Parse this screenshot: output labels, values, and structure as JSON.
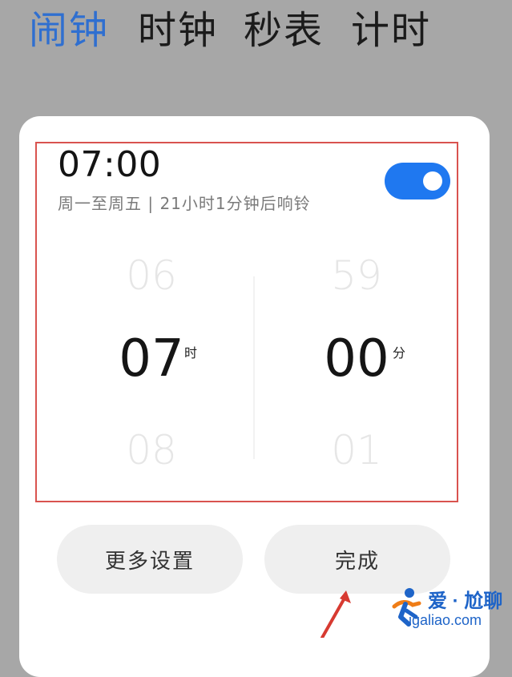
{
  "tabs": [
    {
      "label": "闹钟",
      "active": true
    },
    {
      "label": "时钟",
      "active": false
    },
    {
      "label": "秒表",
      "active": false
    },
    {
      "label": "计时",
      "active": false
    }
  ],
  "alarm": {
    "time": "07:00",
    "info": "周一至周五 | 21小时1分钟后响铃",
    "enabled": true
  },
  "picker": {
    "hour": {
      "prev": "06",
      "current": "07",
      "next": "08",
      "unit": "时"
    },
    "minute": {
      "prev": "59",
      "current": "00",
      "next": "01",
      "unit": "分"
    }
  },
  "buttons": {
    "more_settings": "更多设置",
    "done": "完成"
  },
  "watermark": {
    "line1": "爱 · 尬聊",
    "line2": "igaliao.com"
  },
  "colors": {
    "accent": "#1f78f0",
    "active_tab": "#2f6fd0",
    "highlight_border": "#d9534f",
    "background": "#a7a7a7"
  }
}
